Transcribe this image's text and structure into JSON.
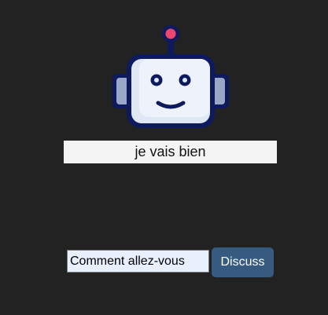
{
  "bot": {
    "avatar_icon": "robot-icon",
    "response_text": "je vais bien"
  },
  "chat": {
    "input_value": "Comment allez-vous",
    "input_placeholder": "",
    "submit_label": "Discuss"
  },
  "colors": {
    "background": "#222222",
    "button": "#365a80",
    "response_bg": "#f4f4f4",
    "input_bg": "#e8f0fe",
    "robot_outline": "#0d1b5e",
    "robot_antenna_tip": "#f0456d"
  }
}
